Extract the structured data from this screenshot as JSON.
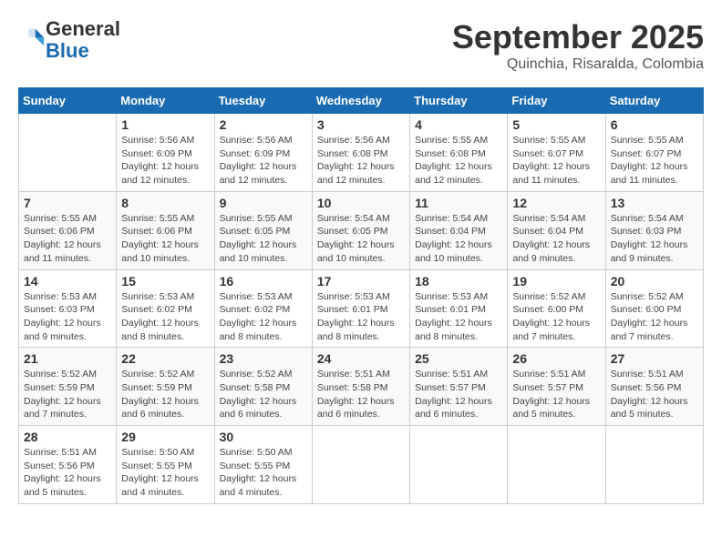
{
  "header": {
    "logo_line1": "General",
    "logo_line2": "Blue",
    "month": "September 2025",
    "location": "Quinchia, Risaralda, Colombia"
  },
  "days_of_week": [
    "Sunday",
    "Monday",
    "Tuesday",
    "Wednesday",
    "Thursday",
    "Friday",
    "Saturday"
  ],
  "weeks": [
    [
      {
        "day": "",
        "info": ""
      },
      {
        "day": "1",
        "info": "Sunrise: 5:56 AM\nSunset: 6:09 PM\nDaylight: 12 hours\nand 12 minutes."
      },
      {
        "day": "2",
        "info": "Sunrise: 5:56 AM\nSunset: 6:09 PM\nDaylight: 12 hours\nand 12 minutes."
      },
      {
        "day": "3",
        "info": "Sunrise: 5:56 AM\nSunset: 6:08 PM\nDaylight: 12 hours\nand 12 minutes."
      },
      {
        "day": "4",
        "info": "Sunrise: 5:55 AM\nSunset: 6:08 PM\nDaylight: 12 hours\nand 12 minutes."
      },
      {
        "day": "5",
        "info": "Sunrise: 5:55 AM\nSunset: 6:07 PM\nDaylight: 12 hours\nand 11 minutes."
      },
      {
        "day": "6",
        "info": "Sunrise: 5:55 AM\nSunset: 6:07 PM\nDaylight: 12 hours\nand 11 minutes."
      }
    ],
    [
      {
        "day": "7",
        "info": "Sunrise: 5:55 AM\nSunset: 6:06 PM\nDaylight: 12 hours\nand 11 minutes."
      },
      {
        "day": "8",
        "info": "Sunrise: 5:55 AM\nSunset: 6:06 PM\nDaylight: 12 hours\nand 10 minutes."
      },
      {
        "day": "9",
        "info": "Sunrise: 5:55 AM\nSunset: 6:05 PM\nDaylight: 12 hours\nand 10 minutes."
      },
      {
        "day": "10",
        "info": "Sunrise: 5:54 AM\nSunset: 6:05 PM\nDaylight: 12 hours\nand 10 minutes."
      },
      {
        "day": "11",
        "info": "Sunrise: 5:54 AM\nSunset: 6:04 PM\nDaylight: 12 hours\nand 10 minutes."
      },
      {
        "day": "12",
        "info": "Sunrise: 5:54 AM\nSunset: 6:04 PM\nDaylight: 12 hours\nand 9 minutes."
      },
      {
        "day": "13",
        "info": "Sunrise: 5:54 AM\nSunset: 6:03 PM\nDaylight: 12 hours\nand 9 minutes."
      }
    ],
    [
      {
        "day": "14",
        "info": "Sunrise: 5:53 AM\nSunset: 6:03 PM\nDaylight: 12 hours\nand 9 minutes."
      },
      {
        "day": "15",
        "info": "Sunrise: 5:53 AM\nSunset: 6:02 PM\nDaylight: 12 hours\nand 8 minutes."
      },
      {
        "day": "16",
        "info": "Sunrise: 5:53 AM\nSunset: 6:02 PM\nDaylight: 12 hours\nand 8 minutes."
      },
      {
        "day": "17",
        "info": "Sunrise: 5:53 AM\nSunset: 6:01 PM\nDaylight: 12 hours\nand 8 minutes."
      },
      {
        "day": "18",
        "info": "Sunrise: 5:53 AM\nSunset: 6:01 PM\nDaylight: 12 hours\nand 8 minutes."
      },
      {
        "day": "19",
        "info": "Sunrise: 5:52 AM\nSunset: 6:00 PM\nDaylight: 12 hours\nand 7 minutes."
      },
      {
        "day": "20",
        "info": "Sunrise: 5:52 AM\nSunset: 6:00 PM\nDaylight: 12 hours\nand 7 minutes."
      }
    ],
    [
      {
        "day": "21",
        "info": "Sunrise: 5:52 AM\nSunset: 5:59 PM\nDaylight: 12 hours\nand 7 minutes."
      },
      {
        "day": "22",
        "info": "Sunrise: 5:52 AM\nSunset: 5:59 PM\nDaylight: 12 hours\nand 6 minutes."
      },
      {
        "day": "23",
        "info": "Sunrise: 5:52 AM\nSunset: 5:58 PM\nDaylight: 12 hours\nand 6 minutes."
      },
      {
        "day": "24",
        "info": "Sunrise: 5:51 AM\nSunset: 5:58 PM\nDaylight: 12 hours\nand 6 minutes."
      },
      {
        "day": "25",
        "info": "Sunrise: 5:51 AM\nSunset: 5:57 PM\nDaylight: 12 hours\nand 6 minutes."
      },
      {
        "day": "26",
        "info": "Sunrise: 5:51 AM\nSunset: 5:57 PM\nDaylight: 12 hours\nand 5 minutes."
      },
      {
        "day": "27",
        "info": "Sunrise: 5:51 AM\nSunset: 5:56 PM\nDaylight: 12 hours\nand 5 minutes."
      }
    ],
    [
      {
        "day": "28",
        "info": "Sunrise: 5:51 AM\nSunset: 5:56 PM\nDaylight: 12 hours\nand 5 minutes."
      },
      {
        "day": "29",
        "info": "Sunrise: 5:50 AM\nSunset: 5:55 PM\nDaylight: 12 hours\nand 4 minutes."
      },
      {
        "day": "30",
        "info": "Sunrise: 5:50 AM\nSunset: 5:55 PM\nDaylight: 12 hours\nand 4 minutes."
      },
      {
        "day": "",
        "info": ""
      },
      {
        "day": "",
        "info": ""
      },
      {
        "day": "",
        "info": ""
      },
      {
        "day": "",
        "info": ""
      }
    ]
  ]
}
